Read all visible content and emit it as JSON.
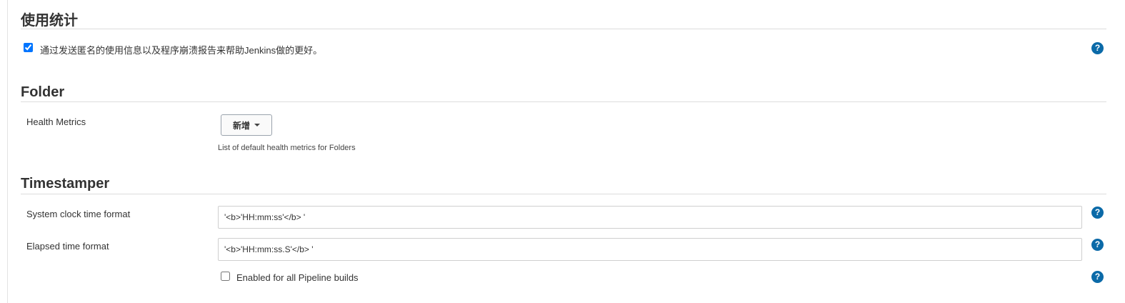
{
  "usage": {
    "title": "使用统计",
    "checkbox_label": "通过发送匿名的使用信息以及程序崩溃报告来帮助Jenkins做的更好。",
    "checked": true
  },
  "folder": {
    "title": "Folder",
    "health_label": "Health Metrics",
    "add_button": "新增",
    "description": "List of default health metrics for Folders"
  },
  "timestamper": {
    "title": "Timestamper",
    "system_label": "System clock time format",
    "system_value": "'<b>'HH:mm:ss'</b> '",
    "elapsed_label": "Elapsed time format",
    "elapsed_value": "'<b>'HH:mm:ss.S'</b> '",
    "pipeline_label": "Enabled for all Pipeline builds",
    "pipeline_checked": false
  },
  "help_glyph": "?",
  "icons": {
    "help": "help-icon",
    "dropdown": "caret-down-icon"
  },
  "colors": {
    "help_icon": "#0b6aa8"
  }
}
